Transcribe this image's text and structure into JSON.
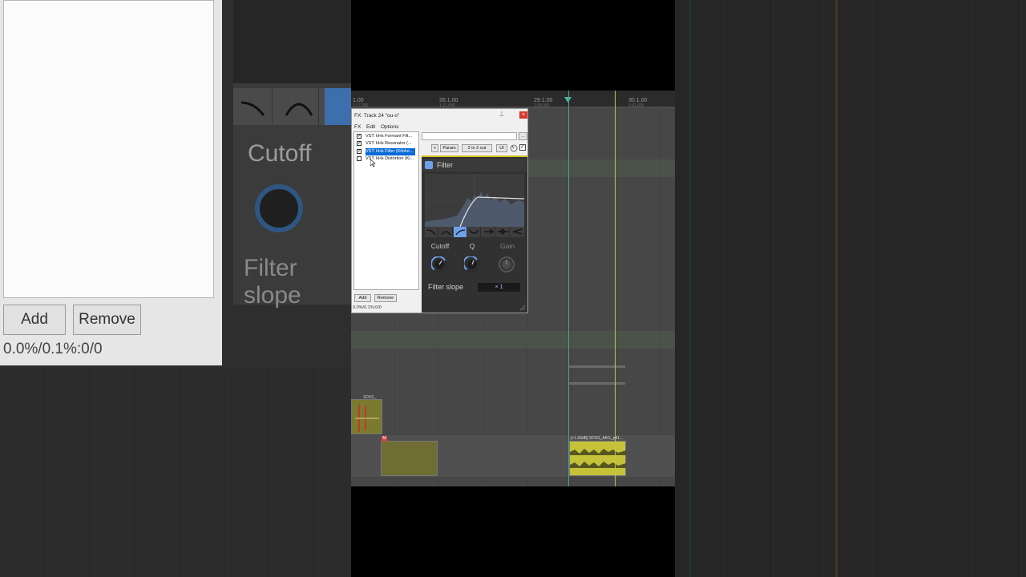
{
  "background": {
    "add_label": "Add",
    "remove_label": "Remove",
    "status": "0.0%/0.1%:0/0",
    "cutoff_label": "Cutoff",
    "filter_slope_label": "Filter slope"
  },
  "ruler": {
    "marks": [
      {
        "label": "1.00",
        "sub": "1:17.000"
      },
      {
        "label": "28.1.00",
        "sub": "1:21.000"
      },
      {
        "label": "29.1.00",
        "sub": "1:28.000"
      },
      {
        "label": "30.1.00",
        "sub": "1:31.000"
      }
    ]
  },
  "items": {
    "item_a_label": "SDSS_",
    "item_c_label": "[+1.00dB] SDSS_AKG_p41...",
    "mute_badge": "M"
  },
  "fx_window": {
    "title": "FX: Track 24 \"ou-o\"",
    "close_glyph": "×",
    "pin_glyph": "⊥",
    "menu": [
      "FX",
      "Edit",
      "Options"
    ],
    "fx_chain": [
      {
        "label": "VST: kHs Formant Filt...",
        "checked": true,
        "selected": false
      },
      {
        "label": "VST: kHs Resonator (...",
        "checked": true,
        "selected": false
      },
      {
        "label": "VST: kHs Filter (Kilohe...",
        "checked": true,
        "selected": true
      },
      {
        "label": "VST: kHs Distortion (Ki...",
        "checked": false,
        "selected": false
      }
    ],
    "add_label": "Add",
    "remove_label": "Remove",
    "status": "0.0%/0.1%:0/0",
    "preset_value": "",
    "preset_more": "...",
    "toolbar": {
      "plus_label": "+",
      "param_label": "Param",
      "io_label": "2 in 2 out",
      "ui_label": "UI"
    }
  },
  "plugin": {
    "name": "Filter",
    "accent_color": "#6ea1e8",
    "knobs": [
      {
        "label": "Cutoff",
        "enabled": true
      },
      {
        "label": "Q",
        "enabled": true
      },
      {
        "label": "Gain",
        "enabled": false
      }
    ],
    "filter_slope_label": "Filter slope",
    "filter_slope_value": "× 1",
    "shape_icons": [
      "high-shelf-icon",
      "peak-icon",
      "highpass-icon",
      "notch-icon",
      "lowpass-icon",
      "bandpass-icon",
      "low-shelf-icon"
    ],
    "active_shape": 2
  },
  "check_glyph": "✓"
}
